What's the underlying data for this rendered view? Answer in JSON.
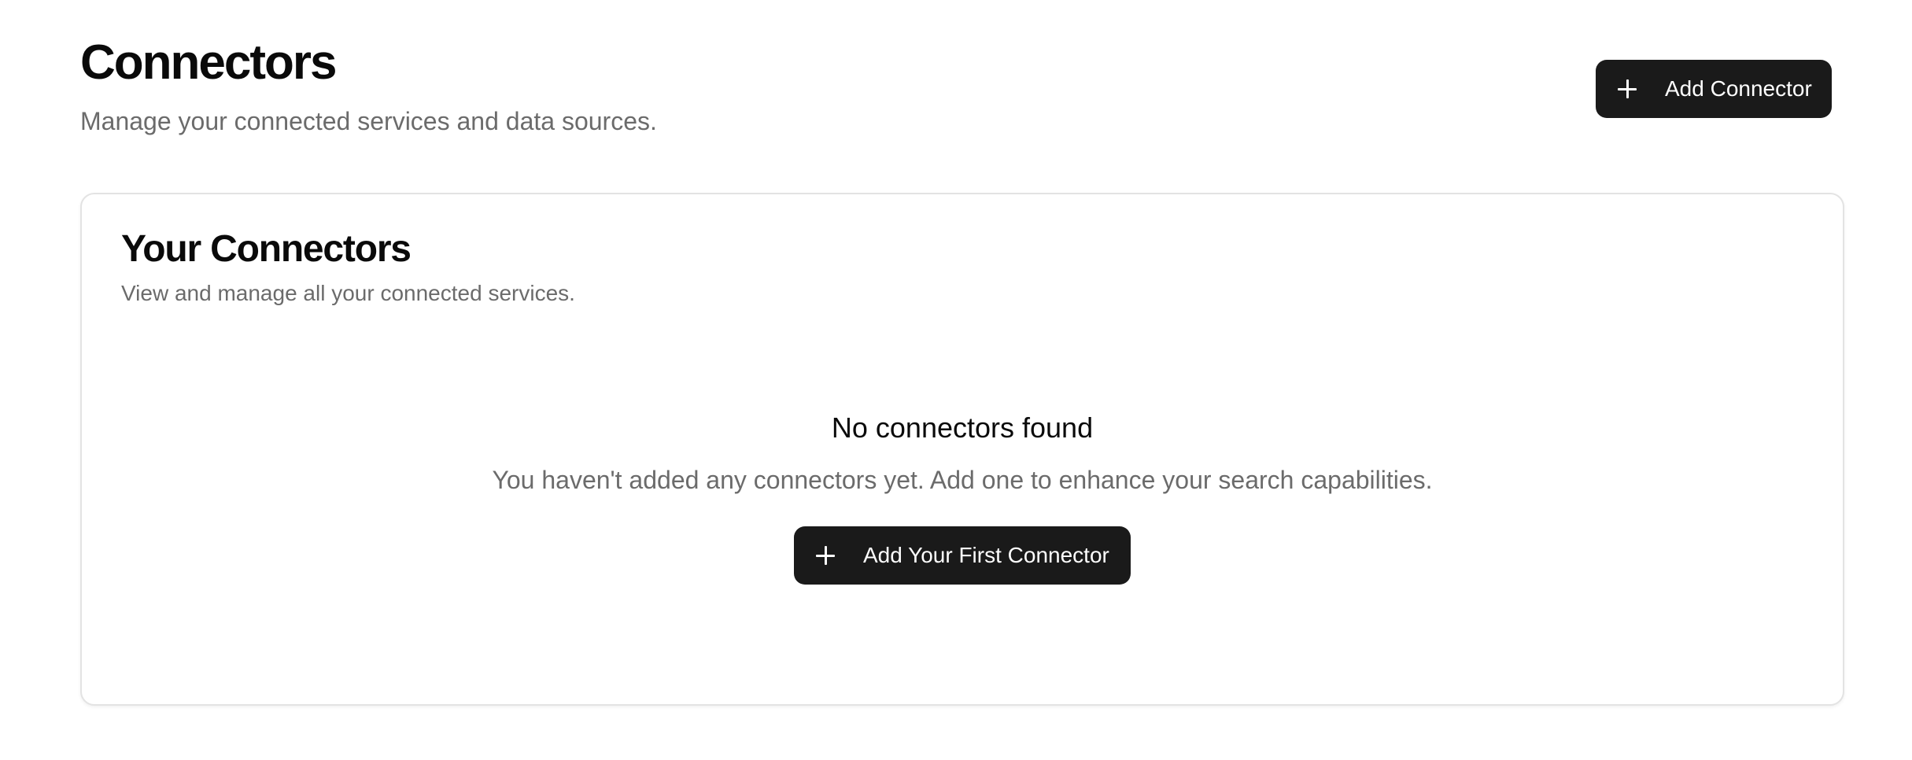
{
  "header": {
    "title": "Connectors",
    "subtitle": "Manage your connected services and data sources.",
    "add_button_label": "Add Connector",
    "add_button_icon": "plus-icon"
  },
  "card": {
    "title": "Your Connectors",
    "subtitle": "View and manage all your connected services.",
    "empty_state": {
      "title": "No connectors found",
      "description": "You haven't added any connectors yet. Add one to enhance your search capabilities.",
      "button_label": "Add Your First Connector",
      "button_icon": "plus-icon"
    }
  },
  "colors": {
    "button_background": "#1a1a1a",
    "button_text": "#ffffff",
    "muted_text": "#6b6b6b",
    "card_border": "#e3e3e3"
  }
}
